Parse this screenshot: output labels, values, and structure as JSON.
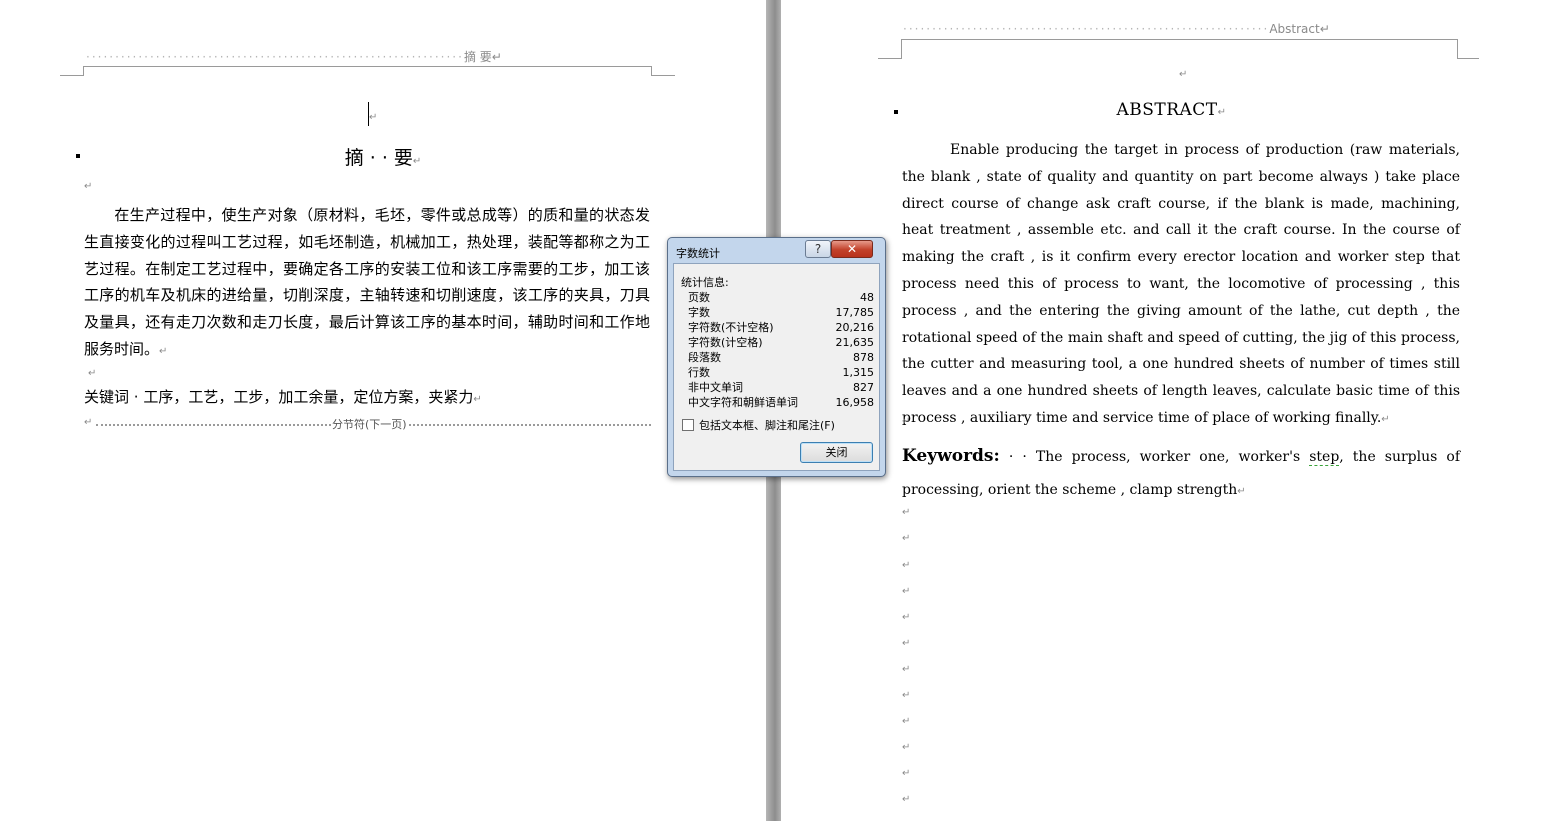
{
  "left_page": {
    "header_label": "摘  要",
    "title": "摘 · · 要",
    "paragraph": "在生产过程中，使生产对象（原材料，毛坯，零件或总成等）的质和量的状态发生直接变化的过程叫工艺过程，如毛坯制造，机械加工，热处理，装配等都称之为工艺过程。在制定工艺过程中，要确定各工序的安装工位和该工序需要的工步，加工该工序的机车及机床的进给量，切削深度，主轴转速和切削速度，该工序的夹具，刀具及量具，还有走刀次数和走刀长度，最后计算该工序的基本时间，辅助时间和工作地服务时间。",
    "keywords_label": "关键词",
    "keywords": "工序，工艺，工步，加工余量，定位方案，夹紧力",
    "section_break": "分节符(下一页)"
  },
  "right_page": {
    "header_label": "Abstract",
    "title": "ABSTRACT",
    "paragraph": "Enable producing the target in process of production (raw materials, the blank , state of quality and quantity on part become always ) take place direct course of change ask craft course, if the blank is made, machining, heat treatment , assemble etc. and call it the craft course. In the course of making the craft , is it confirm every erector location and worker step that process need this of process to want, the locomotive of processing , this process , and the entering the giving amount of the lathe, cut depth , the rotational speed of the main shaft and speed of cutting, the jig of this process, the cutter and measuring tool, a one hundred sheets of number of times still leaves and a one hundred sheets of length leaves, calculate basic time of this process , auxiliary time and service time of place of working finally.",
    "keywords_label": "Keywords:",
    "keywords_a": "The process, worker one, worker's",
    "keywords_flag": "step",
    "keywords_b": ", the surplus of processing, orient the scheme , clamp strength"
  },
  "dialog": {
    "title": "字数统计",
    "help_glyph": "?",
    "close_glyph": "✕",
    "group_label": "统计信息:",
    "stats": [
      {
        "label": "页数",
        "value": "48"
      },
      {
        "label": "字数",
        "value": "17,785"
      },
      {
        "label": "字符数(不计空格)",
        "value": "20,216"
      },
      {
        "label": "字符数(计空格)",
        "value": "21,635"
      },
      {
        "label": "段落数",
        "value": "878"
      },
      {
        "label": "行数",
        "value": "1,315"
      },
      {
        "label": "非中文单词",
        "value": "827"
      },
      {
        "label": "中文字符和朝鲜语单词",
        "value": "16,958"
      }
    ],
    "checkbox_label": "包括文本框、脚注和尾注(F)",
    "checkbox_checked": false,
    "close_button": "关闭"
  },
  "marks": {
    "return": "↵"
  }
}
